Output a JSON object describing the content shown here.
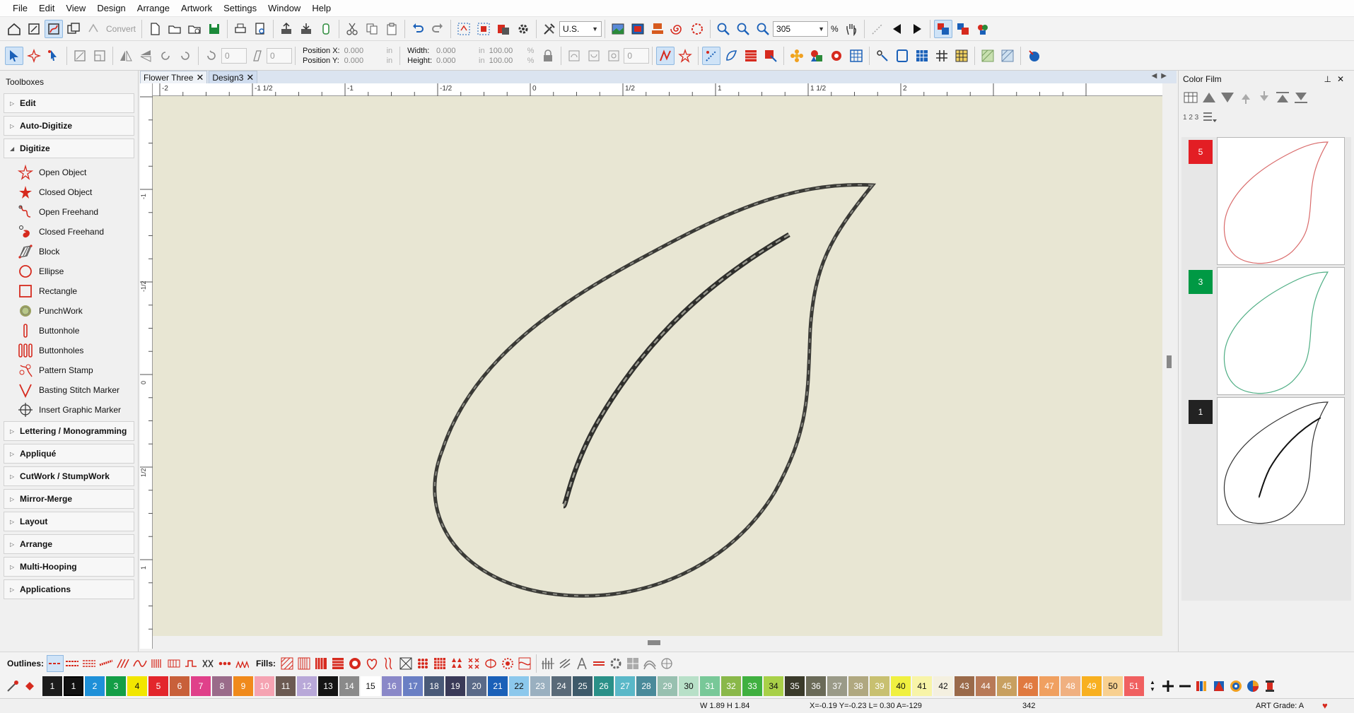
{
  "menu": [
    "File",
    "Edit",
    "View",
    "Design",
    "Arrange",
    "Artwork",
    "Settings",
    "Window",
    "Help"
  ],
  "toolbar": {
    "convert_label": "Convert",
    "units": "U.S.",
    "zoom": "305",
    "zoom_unit": "%"
  },
  "props": {
    "pos_x_label": "Position X:",
    "pos_x": "0.000",
    "pos_y_label": "Position Y:",
    "pos_y": "0.000",
    "width_label": "Width:",
    "width": "0.000",
    "height_label": "Height:",
    "height": "0.000",
    "unit": "in",
    "width_pct": "100.00",
    "height_pct": "100.00",
    "pct": "%",
    "rotate": "0",
    "slant": "0",
    "extra": "0"
  },
  "toolboxes": {
    "title": "Toolboxes",
    "sections_top": [
      "Edit",
      "Auto-Digitize"
    ],
    "digitize_label": "Digitize",
    "digitize_items": [
      {
        "label": "Open Object",
        "icon": "open-object-icon"
      },
      {
        "label": "Closed Object",
        "icon": "closed-object-icon"
      },
      {
        "label": "Open Freehand",
        "icon": "open-freehand-icon"
      },
      {
        "label": "Closed Freehand",
        "icon": "closed-freehand-icon"
      },
      {
        "label": "Block",
        "icon": "block-icon"
      },
      {
        "label": "Ellipse",
        "icon": "ellipse-icon"
      },
      {
        "label": "Rectangle",
        "icon": "rectangle-icon"
      },
      {
        "label": "PunchWork",
        "icon": "punchwork-icon"
      },
      {
        "label": "Buttonhole",
        "icon": "buttonhole-icon"
      },
      {
        "label": "Buttonholes",
        "icon": "buttonholes-icon"
      },
      {
        "label": "Pattern Stamp",
        "icon": "pattern-stamp-icon"
      },
      {
        "label": "Basting Stitch Marker",
        "icon": "basting-stitch-icon"
      },
      {
        "label": "Insert Graphic Marker",
        "icon": "insert-graphic-icon"
      }
    ],
    "sections_bottom": [
      "Lettering / Monogramming",
      "Appliqué",
      "CutWork / StumpWork",
      "Mirror-Merge",
      "Layout",
      "Arrange",
      "Multi-Hooping",
      "Applications"
    ]
  },
  "tabs": [
    {
      "label": "Flower Three",
      "active": false
    },
    {
      "label": "Design3",
      "active": true
    }
  ],
  "ruler": {
    "h_labels": [
      "-2",
      "-1 1/2",
      "-1",
      "-1/2",
      "0",
      "1/2",
      "1",
      "1 1/2",
      "2"
    ],
    "v_labels": [
      "-1",
      "-1/2",
      "0",
      "1/2",
      "1"
    ]
  },
  "color_film": {
    "title": "Color Film",
    "seq_label": "1 2 3",
    "items": [
      {
        "number": "5",
        "color": "#e31e24",
        "stroke": "#d96b6b"
      },
      {
        "number": "3",
        "color": "#009944",
        "stroke": "#4fae84"
      },
      {
        "number": "1",
        "color": "#222222",
        "stroke": "#333333"
      }
    ]
  },
  "outlines_label": "Outlines:",
  "fills_label": "Fills:",
  "palette": [
    {
      "n": "1",
      "bg": "#1c1c1c",
      "fg": "#ffffff"
    },
    {
      "n": "1",
      "bg": "#111111",
      "fg": "#ffffff",
      "selected": true
    },
    {
      "n": "2",
      "bg": "#1e90d8",
      "fg": "#ffffff"
    },
    {
      "n": "3",
      "bg": "#139e46",
      "fg": "#ffffff"
    },
    {
      "n": "4",
      "bg": "#f2e600",
      "fg": "#111111"
    },
    {
      "n": "5",
      "bg": "#e3262c",
      "fg": "#ffffff"
    },
    {
      "n": "6",
      "bg": "#c8603a",
      "fg": "#ffffff"
    },
    {
      "n": "7",
      "bg": "#e0408a",
      "fg": "#ffffff"
    },
    {
      "n": "8",
      "bg": "#9a6b8a",
      "fg": "#ffffff"
    },
    {
      "n": "9",
      "bg": "#f08a1c",
      "fg": "#ffffff"
    },
    {
      "n": "10",
      "bg": "#f5a3b2",
      "fg": "#ffffff"
    },
    {
      "n": "11",
      "bg": "#6b5a52",
      "fg": "#ffffff"
    },
    {
      "n": "12",
      "bg": "#b8a8d8",
      "fg": "#ffffff"
    },
    {
      "n": "13",
      "bg": "#141414",
      "fg": "#ffffff"
    },
    {
      "n": "14",
      "bg": "#8a8a8a",
      "fg": "#ffffff"
    },
    {
      "n": "15",
      "bg": "#ffffff",
      "fg": "#111111"
    },
    {
      "n": "16",
      "bg": "#8a88c8",
      "fg": "#ffffff"
    },
    {
      "n": "17",
      "bg": "#6a7fc4",
      "fg": "#ffffff"
    },
    {
      "n": "18",
      "bg": "#4a5a78",
      "fg": "#ffffff"
    },
    {
      "n": "19",
      "bg": "#3a3a58",
      "fg": "#ffffff"
    },
    {
      "n": "20",
      "bg": "#5a6a88",
      "fg": "#ffffff"
    },
    {
      "n": "21",
      "bg": "#1a60b8",
      "fg": "#ffffff"
    },
    {
      "n": "22",
      "bg": "#8cc8ec",
      "fg": "#111111"
    },
    {
      "n": "23",
      "bg": "#9ab0c0",
      "fg": "#ffffff"
    },
    {
      "n": "24",
      "bg": "#5a6a78",
      "fg": "#ffffff"
    },
    {
      "n": "25",
      "bg": "#3e5a6a",
      "fg": "#ffffff"
    },
    {
      "n": "26",
      "bg": "#2a9088",
      "fg": "#ffffff"
    },
    {
      "n": "27",
      "bg": "#5ab8c8",
      "fg": "#ffffff"
    },
    {
      "n": "28",
      "bg": "#4a8a9a",
      "fg": "#ffffff"
    },
    {
      "n": "29",
      "bg": "#98c0b0",
      "fg": "#ffffff"
    },
    {
      "n": "30",
      "bg": "#b8e0c8",
      "fg": "#111111"
    },
    {
      "n": "31",
      "bg": "#78c898",
      "fg": "#ffffff"
    },
    {
      "n": "32",
      "bg": "#8ab84a",
      "fg": "#ffffff"
    },
    {
      "n": "33",
      "bg": "#40b040",
      "fg": "#ffffff"
    },
    {
      "n": "34",
      "bg": "#a8d048",
      "fg": "#111111"
    },
    {
      "n": "35",
      "bg": "#3a3a2a",
      "fg": "#ffffff"
    },
    {
      "n": "36",
      "bg": "#6a6a58",
      "fg": "#ffffff"
    },
    {
      "n": "37",
      "bg": "#9a9a88",
      "fg": "#ffffff"
    },
    {
      "n": "38",
      "bg": "#b0a880",
      "fg": "#ffffff"
    },
    {
      "n": "39",
      "bg": "#c8c070",
      "fg": "#ffffff"
    },
    {
      "n": "40",
      "bg": "#f0f040",
      "fg": "#111111"
    },
    {
      "n": "41",
      "bg": "#f8f4a8",
      "fg": "#111111"
    },
    {
      "n": "42",
      "bg": "#f4f0e0",
      "fg": "#111111"
    },
    {
      "n": "43",
      "bg": "#9a6a4a",
      "fg": "#ffffff"
    },
    {
      "n": "44",
      "bg": "#b87a58",
      "fg": "#ffffff"
    },
    {
      "n": "45",
      "bg": "#c8a060",
      "fg": "#ffffff"
    },
    {
      "n": "46",
      "bg": "#e07a40",
      "fg": "#ffffff"
    },
    {
      "n": "47",
      "bg": "#f0a060",
      "fg": "#ffffff"
    },
    {
      "n": "48",
      "bg": "#f0b080",
      "fg": "#ffffff"
    },
    {
      "n": "49",
      "bg": "#f8b020",
      "fg": "#ffffff"
    },
    {
      "n": "50",
      "bg": "#f8d090",
      "fg": "#111111"
    },
    {
      "n": "51",
      "bg": "#f06060",
      "fg": "#ffffff"
    }
  ],
  "status": {
    "size": "W 1.89 H 1.84",
    "coords": "X=-0.19 Y=-0.23 L= 0.30 A=-129",
    "stitches": "342",
    "grade": "ART Grade: A",
    "heart": "♥"
  },
  "colors": {
    "canvas": "#e8e6d3",
    "accent_red": "#d62a1e",
    "selected_bg": "#cfe3f7"
  }
}
